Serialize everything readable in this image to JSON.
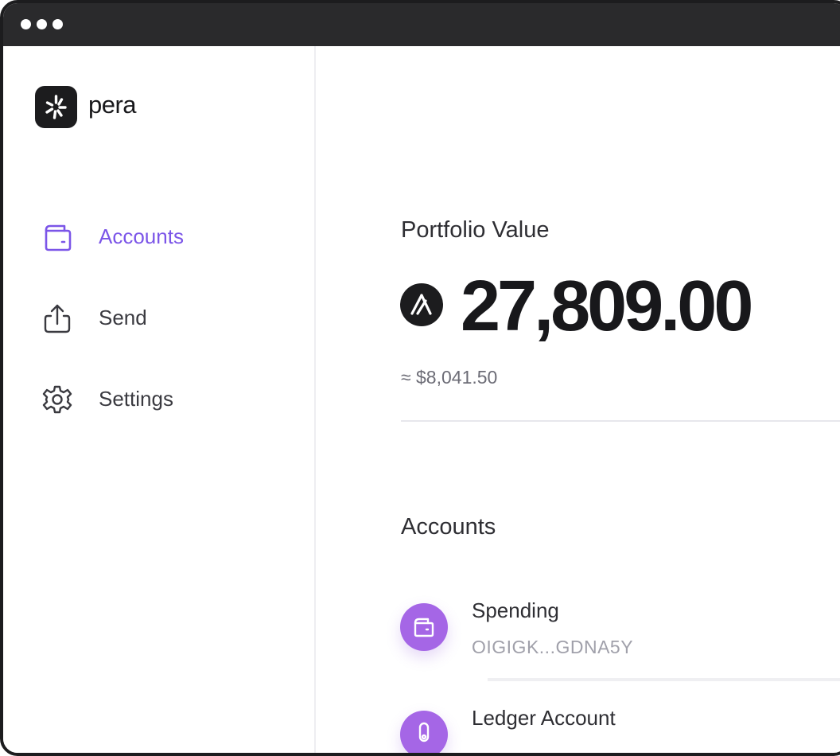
{
  "app": {
    "name": "pera"
  },
  "sidebar": {
    "items": [
      {
        "label": "Accounts",
        "icon": "wallet-icon",
        "active": true
      },
      {
        "label": "Send",
        "icon": "share-upload-icon",
        "active": false
      },
      {
        "label": "Settings",
        "icon": "gear-icon",
        "active": false
      }
    ]
  },
  "portfolio": {
    "label": "Portfolio Value",
    "currency_icon": "algo-icon",
    "value": "27,809.00",
    "usd": "≈ $8,041.50"
  },
  "accounts": {
    "heading": "Accounts",
    "items": [
      {
        "name": "Spending",
        "address": "OIGIGK...GDNA5Y",
        "icon": "wallet-icon"
      },
      {
        "name": "Ledger Account",
        "address": "",
        "icon": "ledger-icon"
      }
    ]
  },
  "colors": {
    "accent": "#7b55e8",
    "avatar": "#a566e6",
    "titlebar": "#2a2a2c",
    "text": "#18181b"
  }
}
